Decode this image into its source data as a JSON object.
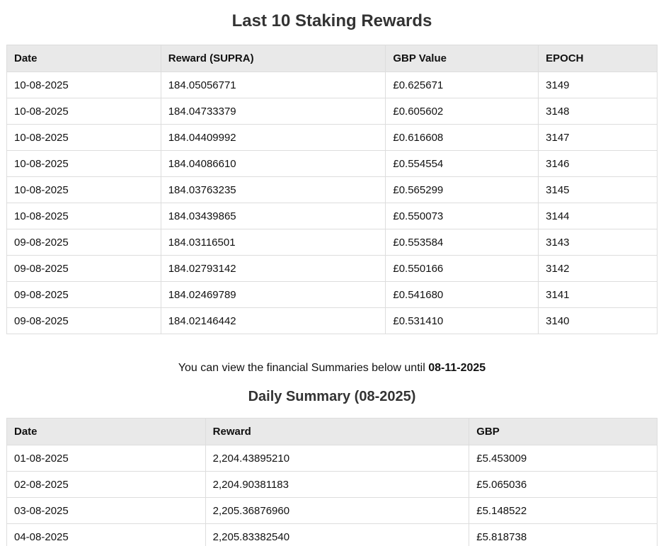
{
  "rewards": {
    "title": "Last 10 Staking Rewards",
    "headers": [
      "Date",
      "Reward (SUPRA)",
      "GBP Value",
      "EPOCH"
    ],
    "rows": [
      [
        "10-08-2025",
        "184.05056771",
        "£0.625671",
        "3149"
      ],
      [
        "10-08-2025",
        "184.04733379",
        "£0.605602",
        "3148"
      ],
      [
        "10-08-2025",
        "184.04409992",
        "£0.616608",
        "3147"
      ],
      [
        "10-08-2025",
        "184.04086610",
        "£0.554554",
        "3146"
      ],
      [
        "10-08-2025",
        "184.03763235",
        "£0.565299",
        "3145"
      ],
      [
        "10-08-2025",
        "184.03439865",
        "£0.550073",
        "3144"
      ],
      [
        "09-08-2025",
        "184.03116501",
        "£0.553584",
        "3143"
      ],
      [
        "09-08-2025",
        "184.02793142",
        "£0.550166",
        "3142"
      ],
      [
        "09-08-2025",
        "184.02469789",
        "£0.541680",
        "3141"
      ],
      [
        "09-08-2025",
        "184.02146442",
        "£0.531410",
        "3140"
      ]
    ]
  },
  "notice": {
    "text": "You can view the financial Summaries below until ",
    "date": "08-11-2025"
  },
  "daily": {
    "title": "Daily Summary (08-2025)",
    "headers": [
      "Date",
      "Reward",
      "GBP"
    ],
    "rows": [
      [
        "01-08-2025",
        "2,204.43895210",
        "£5.453009"
      ],
      [
        "02-08-2025",
        "2,204.90381183",
        "£5.065036"
      ],
      [
        "03-08-2025",
        "2,205.36876960",
        "£5.148522"
      ],
      [
        "04-08-2025",
        "2,205.83382540",
        "£5.818738"
      ]
    ]
  }
}
